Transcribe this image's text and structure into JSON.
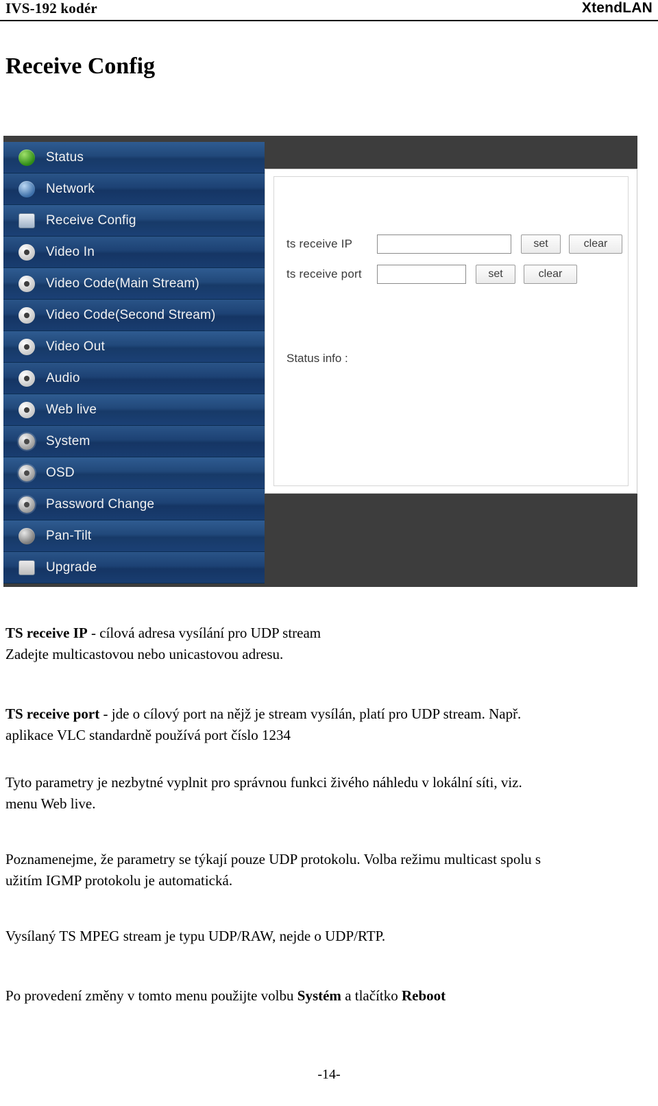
{
  "header": {
    "left": "IVS-192 kodér",
    "right": "XtendLAN"
  },
  "title": "Receive Config",
  "screenshot": {
    "sidebar": [
      {
        "label": "Status",
        "icon": "status-icon"
      },
      {
        "label": "Network",
        "icon": "network-icon"
      },
      {
        "label": "Receive Config",
        "icon": "receive-config-icon"
      },
      {
        "label": "Video In",
        "icon": "video-in-icon"
      },
      {
        "label": "Video Code(Main Stream)",
        "icon": "video-code-main-icon"
      },
      {
        "label": "Video Code(Second Stream)",
        "icon": "video-code-second-icon"
      },
      {
        "label": "Video Out",
        "icon": "video-out-icon"
      },
      {
        "label": "Audio",
        "icon": "audio-icon"
      },
      {
        "label": "Web live",
        "icon": "web-live-icon"
      },
      {
        "label": "System",
        "icon": "system-gear-icon"
      },
      {
        "label": "OSD",
        "icon": "osd-gear-icon"
      },
      {
        "label": "Password Change",
        "icon": "password-change-gear-icon"
      },
      {
        "label": "Pan-Tilt",
        "icon": "pan-tilt-icon"
      },
      {
        "label": "Upgrade",
        "icon": "upgrade-icon"
      }
    ],
    "form": {
      "ip_label": "ts receive IP",
      "ip_value": "",
      "ip_set": "set",
      "ip_clear": "clear",
      "port_label": "ts receive port",
      "port_value": "",
      "port_set": "set",
      "port_clear": "clear",
      "status_info": "Status info :"
    }
  },
  "body": {
    "p1_bold": "TS receive IP",
    "p1_rest": " -  cílová adresa vysílání pro UDP stream",
    "p2": "Zadejte multicastovou nebo unicastovou adresu.",
    "p3_bold": "TS receive port",
    "p3_rest": " -  jde o cílový port na nějž je stream vysílán, platí pro UDP stream. Např.",
    "p4": "aplikace VLC standardně používá port číslo 1234",
    "p5": "Tyto parametry je nezbytné vyplnit pro správnou funkci živého náhledu v lokální síti, viz.",
    "p6": "menu Web live.",
    "p7": "Poznamenejme, že parametry se týkají pouze UDP protokolu. Volba režimu multicast spolu s",
    "p8": "užitím IGMP protokolu je automatická.",
    "p9": "Vysílaný TS MPEG stream je typu UDP/RAW, nejde o UDP/RTP.",
    "p10_a": "Po provedení změny v tomto menu použijte volbu ",
    "p10_b": "Systém",
    "p10_c": " a tlačítko ",
    "p10_d": "Reboot"
  },
  "page_number": "-14-"
}
